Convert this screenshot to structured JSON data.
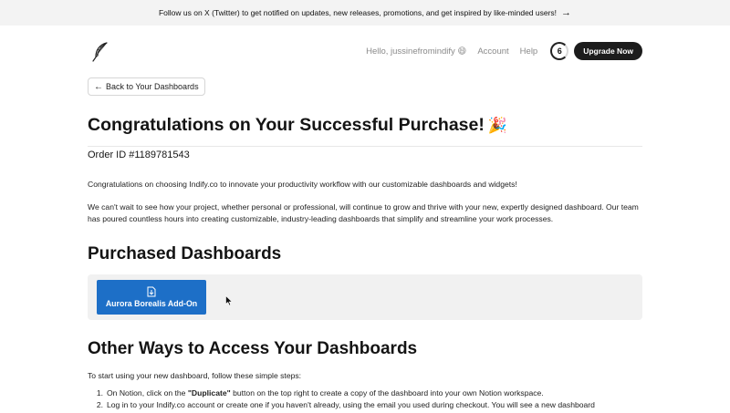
{
  "banner": {
    "text": "Follow us on X (Twitter) to get notified on updates, new releases, promotions, and get inspired by like-minded users!",
    "arrow": "→"
  },
  "header": {
    "logo_icon": "feather-icon",
    "greeting": "Hello, jussinefromindify 😄",
    "account_link": "Account",
    "help_link": "Help",
    "streak_count": "6",
    "upgrade_label": "Upgrade Now"
  },
  "back_button": {
    "arrow": "←",
    "label": "Back to Your Dashboards"
  },
  "title": "Congratulations on Your Successful Purchase!",
  "title_emoji": "🎉",
  "order_id": "Order ID #1189781543",
  "paragraphs": {
    "p1": "Congratulations on choosing Indify.co to innovate your productivity workflow with our customizable dashboards and widgets!",
    "p2": "We can't wait to see how your project, whether personal or professional, will continue to grow and thrive with your new, expertly designed dashboard. Our team has poured countless hours into creating customizable, industry-leading dashboards that simplify and streamline your work processes."
  },
  "purchased": {
    "heading": "Purchased Dashboards",
    "items": [
      {
        "label": "Aurora Borealis Add-On",
        "icon": "download-icon"
      }
    ]
  },
  "access": {
    "heading": "Other Ways to Access Your Dashboards",
    "intro": "To start using your new dashboard, follow these simple steps:",
    "steps": [
      {
        "num": "1.",
        "before": "On Notion, click on the ",
        "bold": "\"Duplicate\"",
        "after": " button on the top right to create a copy of the dashboard into your own Notion workspace."
      },
      {
        "num": "2.",
        "before": "Log in to your Indify.co account or create one if you haven't already, using the email you used during checkout. You will see a new dashboard",
        "bold": "",
        "after": ""
      }
    ]
  },
  "colors": {
    "accent_blue": "#1d6fc7",
    "button_dark": "#1c1c1c",
    "banner_bg": "#f3f3f3"
  }
}
